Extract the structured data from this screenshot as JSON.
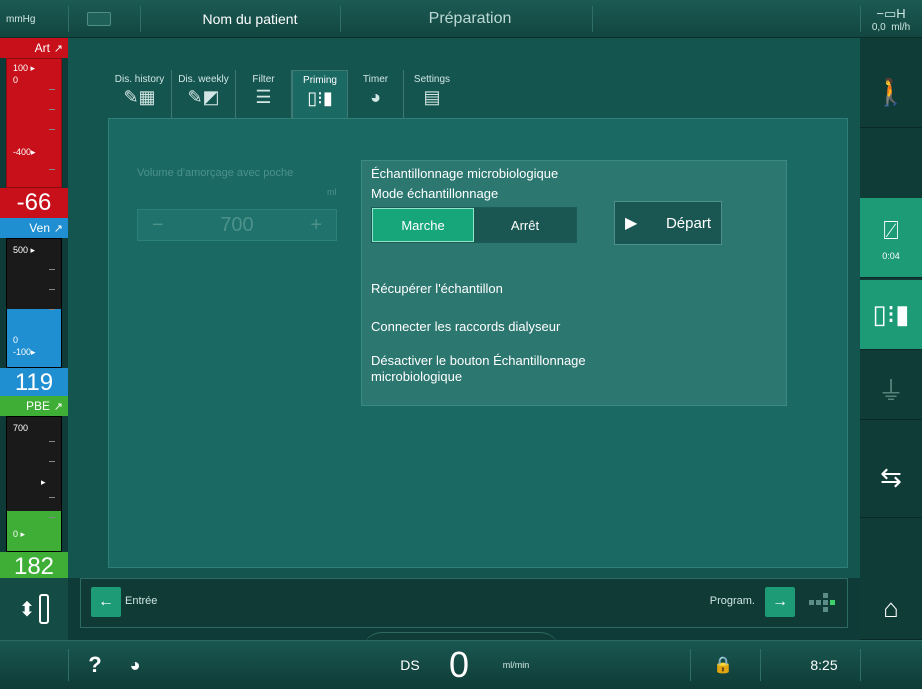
{
  "topbar": {
    "unit": "mmHg",
    "patient_name": "Nom du patient",
    "phase": "Préparation",
    "uf_rate_value": "0,0",
    "uf_rate_unit": "ml/h"
  },
  "left": {
    "art": {
      "label": "Art",
      "scale_top": "100",
      "scale_zero": "0",
      "scale_bottom": "-400",
      "value": "-66"
    },
    "ven": {
      "label": "Ven",
      "scale_top": "500",
      "scale_zero": "0",
      "scale_bottom": "-100",
      "value": "119"
    },
    "pbe": {
      "label": "PBE",
      "scale_top": "700",
      "scale_zero": "0",
      "value": "182"
    }
  },
  "tabs": [
    {
      "label": "Dis. history",
      "icon": "history-icon"
    },
    {
      "label": "Dis. weekly",
      "icon": "weekly-icon"
    },
    {
      "label": "Filter",
      "icon": "filter-icon"
    },
    {
      "label": "Priming",
      "icon": "priming-icon"
    },
    {
      "label": "Timer",
      "icon": "timer-icon"
    },
    {
      "label": "Settings",
      "icon": "settings-icon"
    }
  ],
  "priming": {
    "volume_label": "Volume d'amorçage avec poche",
    "volume_unit": "ml",
    "volume_value": "700",
    "minus": "−",
    "plus": "+"
  },
  "micro": {
    "title": "Échantillonnage microbiologique",
    "mode_label": "Mode échantillonnage",
    "on_label": "Marche",
    "off_label": "Arrêt",
    "start_label": "Départ",
    "step1": "Récupérer l'échantillon",
    "step2": "Connecter les raccords dialyseur",
    "step3_line1": "Désactiver le bouton Échantillonnage",
    "step3_line2": "microbiologique"
  },
  "right": {
    "bypass_time": "0:04"
  },
  "nav": {
    "back_label": "Entrée",
    "forward_label": "Program."
  },
  "status": {
    "ds_label": "DS",
    "flow_value": "0",
    "flow_unit": "ml/min",
    "time": "8:25"
  },
  "colors": {
    "art": "#c7101a",
    "ven": "#1f8fd2",
    "pbe": "#3fae37",
    "accent": "#1d9a76"
  }
}
